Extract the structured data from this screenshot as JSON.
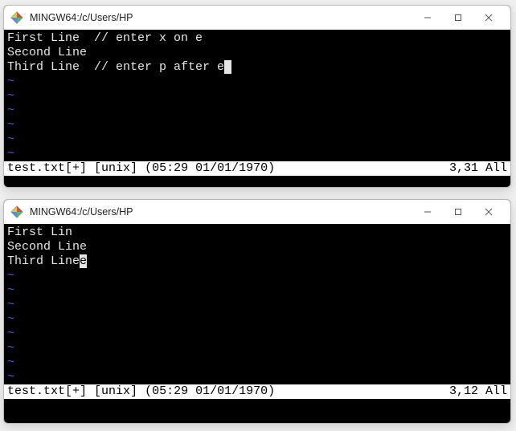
{
  "window1": {
    "title": "MINGW64:/c/Users/HP",
    "lines": [
      "First Line  // enter x on e",
      "Second Line",
      "Third Line  // enter p after e"
    ],
    "tildes": 6,
    "status": {
      "file": "test.txt[+]",
      "format": "[unix]",
      "datetime": "(05:29 01/01/1970)",
      "pos": "3,31",
      "view": "All"
    }
  },
  "window2": {
    "title": "MINGW64:/c/Users/HP",
    "lines": [
      "First Lin",
      "Second Line",
      "Third Linee"
    ],
    "tildes": 8,
    "status": {
      "file": "test.txt[+]",
      "format": "[unix]",
      "datetime": "(05:29 01/01/1970)",
      "pos": "3,12",
      "view": "All"
    }
  }
}
